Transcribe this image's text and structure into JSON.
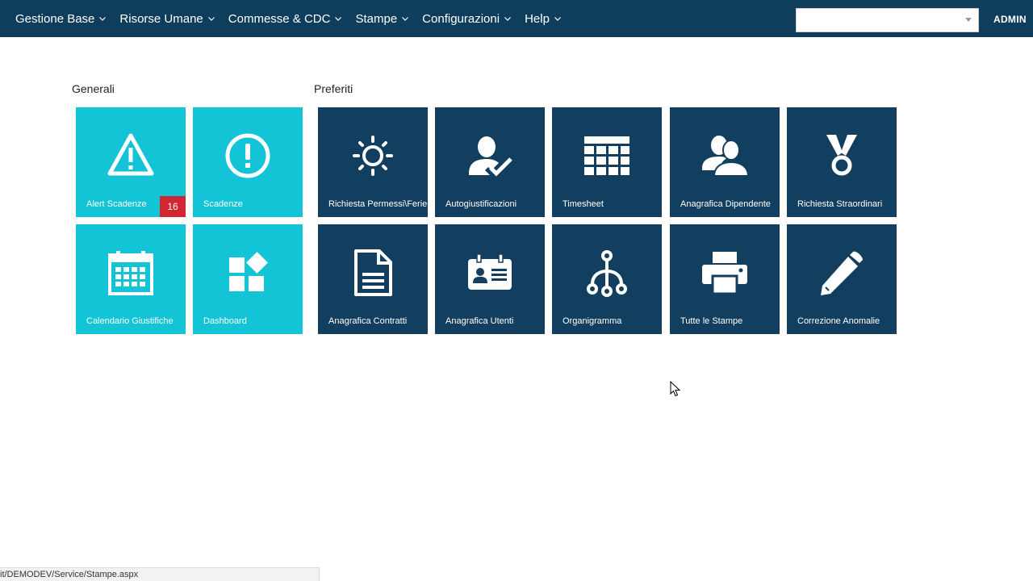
{
  "nav": {
    "menu": [
      {
        "label": "Gestione Base"
      },
      {
        "label": "Risorse Umane"
      },
      {
        "label": "Commesse & CDC"
      },
      {
        "label": "Stampe"
      },
      {
        "label": "Configurazioni"
      },
      {
        "label": "Help"
      }
    ],
    "search_value": "",
    "user": "ADMIN"
  },
  "sections": {
    "generali": "Generali",
    "preferiti": "Preferiti"
  },
  "generali_tiles": [
    {
      "label": "Alert Scadenze",
      "icon": "warning-icon",
      "badge": "16"
    },
    {
      "label": "Scadenze",
      "icon": "exclamation-circle-icon"
    },
    {
      "label": "Calendario Giustifiche",
      "icon": "calendar-icon"
    },
    {
      "label": "Dashboard",
      "icon": "dashboard-icon"
    }
  ],
  "preferiti_tiles": [
    {
      "label": "Richiesta Permessi\\Ferie",
      "icon": "sun-icon"
    },
    {
      "label": "Autogiustificazioni",
      "icon": "user-check-icon"
    },
    {
      "label": "Timesheet",
      "icon": "grid-icon"
    },
    {
      "label": "Anagrafica Dipendente",
      "icon": "users-icon"
    },
    {
      "label": "Richiesta Straordinari",
      "icon": "medal-icon"
    },
    {
      "label": "Anagrafica Contratti",
      "icon": "document-icon"
    },
    {
      "label": "Anagrafica Utenti",
      "icon": "id-card-icon"
    },
    {
      "label": "Organigramma",
      "icon": "org-chart-icon"
    },
    {
      "label": "Tutte le Stampe",
      "icon": "printer-icon"
    },
    {
      "label": "Correzione Anomalie",
      "icon": "pencil-icon"
    }
  ],
  "status_bar": "it/DEMODEV/Service/Stampe.aspx",
  "colors": {
    "navbar": "#0f3d5c",
    "tile_cyan": "#13c3d6",
    "tile_navy": "#123f5f",
    "badge": "#d02733"
  }
}
